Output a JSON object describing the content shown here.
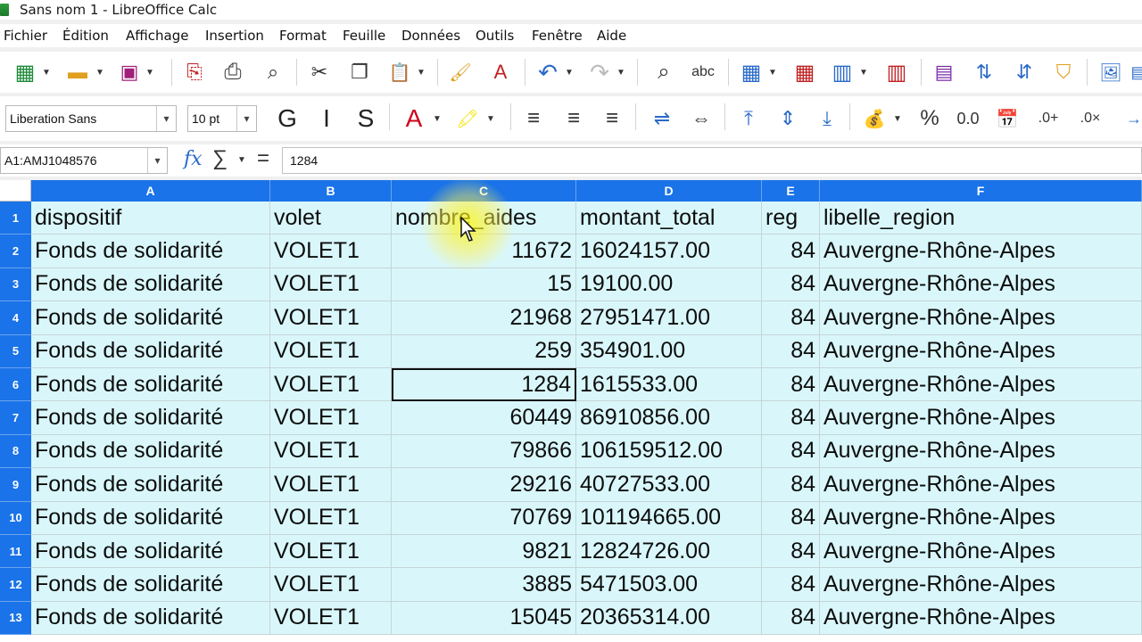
{
  "window": {
    "title": "Sans nom 1 - LibreOffice Calc"
  },
  "menu": [
    "Fichier",
    "Édition",
    "Affichage",
    "Insertion",
    "Format",
    "Feuille",
    "Données",
    "Outils",
    "Fenêtre",
    "Aide"
  ],
  "toolbar2": {
    "font_name": "Liberation Sans",
    "font_size": "10 pt"
  },
  "formula_bar": {
    "name_box": "A1:AMJ1048576",
    "content": "1284"
  },
  "sheet": {
    "columns": [
      "A",
      "B",
      "C",
      "D",
      "E",
      "F"
    ],
    "rows": [
      [
        "dispositif",
        "volet",
        "nombre_aides",
        "montant_total",
        "reg",
        "libelle_region"
      ],
      [
        "Fonds de solidarité",
        "VOLET1",
        "11672",
        "16024157.00",
        "84",
        "Auvergne-Rhône-Alpes"
      ],
      [
        "Fonds de solidarité",
        "VOLET1",
        "15",
        "19100.00",
        "84",
        "Auvergne-Rhône-Alpes"
      ],
      [
        "Fonds de solidarité",
        "VOLET1",
        "21968",
        "27951471.00",
        "84",
        "Auvergne-Rhône-Alpes"
      ],
      [
        "Fonds de solidarité",
        "VOLET1",
        "259",
        "354901.00",
        "84",
        "Auvergne-Rhône-Alpes"
      ],
      [
        "Fonds de solidarité",
        "VOLET1",
        "1284",
        "1615533.00",
        "84",
        "Auvergne-Rhône-Alpes"
      ],
      [
        "Fonds de solidarité",
        "VOLET1",
        "60449",
        "86910856.00",
        "84",
        "Auvergne-Rhône-Alpes"
      ],
      [
        "Fonds de solidarité",
        "VOLET1",
        "79866",
        "106159512.00",
        "84",
        "Auvergne-Rhône-Alpes"
      ],
      [
        "Fonds de solidarité",
        "VOLET1",
        "29216",
        "40727533.00",
        "84",
        "Auvergne-Rhône-Alpes"
      ],
      [
        "Fonds de solidarité",
        "VOLET1",
        "70769",
        "101194665.00",
        "84",
        "Auvergne-Rhône-Alpes"
      ],
      [
        "Fonds de solidarité",
        "VOLET1",
        "9821",
        "12824726.00",
        "84",
        "Auvergne-Rhône-Alpes"
      ],
      [
        "Fonds de solidarité",
        "VOLET1",
        "3885",
        "5471503.00",
        "84",
        "Auvergne-Rhône-Alpes"
      ],
      [
        "Fonds de solidarité",
        "VOLET1",
        "15045",
        "20365314.00",
        "84",
        "Auvergne-Rhône-Alpes"
      ]
    ],
    "numeric_columns": [
      2,
      4
    ],
    "active_cell": "C6"
  },
  "colors": {
    "header_blue": "#1a73e8",
    "cell_fill": "#d9f7fb",
    "accent_red": "#d0021b",
    "accent_yellow": "#f5e500"
  }
}
